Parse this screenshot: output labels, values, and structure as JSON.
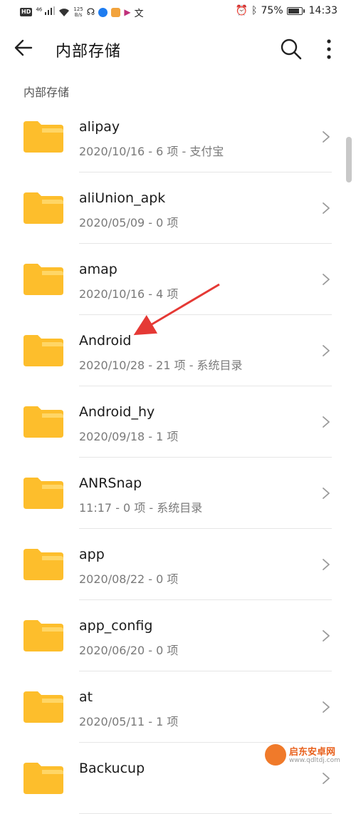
{
  "status_bar": {
    "hd": "HD",
    "net_type": "46",
    "speed_value": "125",
    "speed_unit": "B/s",
    "battery": "75%",
    "time": "14:33"
  },
  "app_bar": {
    "title": "内部存储"
  },
  "breadcrumb": "内部存储",
  "colors": {
    "folder": "#FDBE2C",
    "folder_tab": "#FFD666",
    "arrow": "#E53935"
  },
  "items": [
    {
      "name": "alipay",
      "meta": "2020/10/16 - 6 项 - 支付宝"
    },
    {
      "name": "aliUnion_apk",
      "meta": "2020/05/09 - 0 项"
    },
    {
      "name": "amap",
      "meta": "2020/10/16 - 4 项"
    },
    {
      "name": "Android",
      "meta": "2020/10/28 - 21 项 - 系统目录"
    },
    {
      "name": "Android_hy",
      "meta": "2020/09/18 - 1 项"
    },
    {
      "name": "ANRSnap",
      "meta": "11:17 - 0 项 - 系统目录"
    },
    {
      "name": "app",
      "meta": "2020/08/22 - 0 项"
    },
    {
      "name": "app_config",
      "meta": "2020/06/20 - 0 项"
    },
    {
      "name": "at",
      "meta": "2020/05/11 - 1 项"
    },
    {
      "name": "Backucup",
      "meta": ""
    }
  ],
  "watermark": {
    "brand": "启东安卓网",
    "url": "www.qdltdj.com"
  }
}
